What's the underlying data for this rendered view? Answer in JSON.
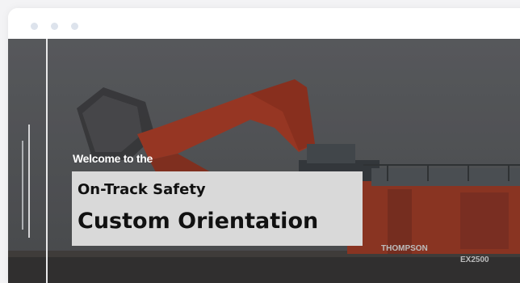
{
  "hero": {
    "welcome": "Welcome to the",
    "title_line1": "On-Track Safety",
    "title_line2": "Custom Orientation",
    "photo_labels": {
      "brand": "THOMPSON",
      "model": "EX2500"
    }
  },
  "colors": {
    "window": "#ffffff",
    "background": "#f3f3f5",
    "title_box": "#d9d9d9",
    "excavator": "#c8442a",
    "text_white": "#ffffff",
    "text_dark": "#111111"
  }
}
